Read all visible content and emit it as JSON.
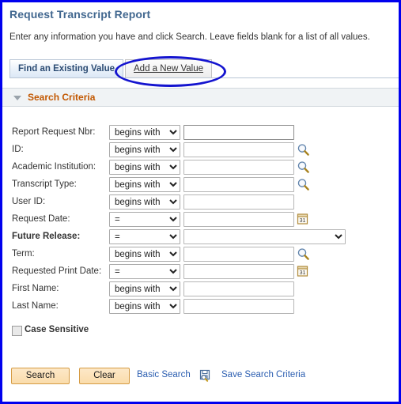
{
  "page": {
    "title": "Request Transcript Report",
    "instructions": "Enter any information you have and click Search. Leave fields blank for a list of all values."
  },
  "tabs": [
    {
      "label": "Find an Existing Value",
      "active": true
    },
    {
      "label": "Add a New Value",
      "active": false,
      "accesskey": "A"
    }
  ],
  "section": {
    "title": "Search Criteria",
    "collapse_icon": "triangle-down-icon",
    "title_color": "#c25700"
  },
  "operators": {
    "begins_with": "begins with",
    "equals": "="
  },
  "fields": [
    {
      "label": "Report Request Nbr:",
      "operator": "begins with",
      "value": "",
      "control": "text",
      "bold": false,
      "icon": "",
      "focused": true
    },
    {
      "label": "ID:",
      "operator": "begins with",
      "value": "",
      "control": "text",
      "bold": false,
      "icon": "search-icon",
      "focused": false
    },
    {
      "label": "Academic Institution:",
      "operator": "begins with",
      "value": "",
      "control": "text",
      "bold": false,
      "icon": "search-icon",
      "focused": false
    },
    {
      "label": "Transcript Type:",
      "operator": "begins with",
      "value": "",
      "control": "text",
      "bold": false,
      "icon": "search-icon",
      "focused": false
    },
    {
      "label": "User ID:",
      "operator": "begins with",
      "value": "",
      "control": "text",
      "bold": false,
      "icon": "",
      "focused": false
    },
    {
      "label": "Request Date:",
      "operator": "=",
      "value": "",
      "control": "text",
      "bold": false,
      "icon": "calendar-icon",
      "focused": false
    },
    {
      "label": "Future Release:",
      "operator": "=",
      "value": "",
      "control": "select",
      "bold": true,
      "icon": "",
      "focused": false
    },
    {
      "label": "Term:",
      "operator": "begins with",
      "value": "",
      "control": "text",
      "bold": false,
      "icon": "search-icon",
      "focused": false
    },
    {
      "label": "Requested Print Date:",
      "operator": "=",
      "value": "",
      "control": "text",
      "bold": false,
      "icon": "calendar-icon",
      "focused": false
    },
    {
      "label": "First Name:",
      "operator": "begins with",
      "value": "",
      "control": "text",
      "bold": false,
      "icon": "",
      "focused": false
    },
    {
      "label": "Last Name:",
      "operator": "begins with",
      "value": "",
      "control": "text",
      "bold": false,
      "icon": "",
      "focused": false
    }
  ],
  "case_sensitive": {
    "label": "Case Sensitive",
    "checked": false
  },
  "actions": {
    "search_button": "Search",
    "clear_button": "Clear",
    "basic_search_link": "Basic Search",
    "save_search_link": "Save Search Criteria",
    "save_icon": "save-search-icon"
  },
  "annotation": {
    "shape": "ellipse",
    "color": "#1414cf",
    "target": "Add a New Value"
  },
  "colors": {
    "title": "#41678f",
    "section_title": "#c25700",
    "link": "#2a5db0",
    "button_fill": "#fadcab",
    "button_border": "#d59b43",
    "annotation": "#1414cf",
    "frame": "#0000ee"
  }
}
